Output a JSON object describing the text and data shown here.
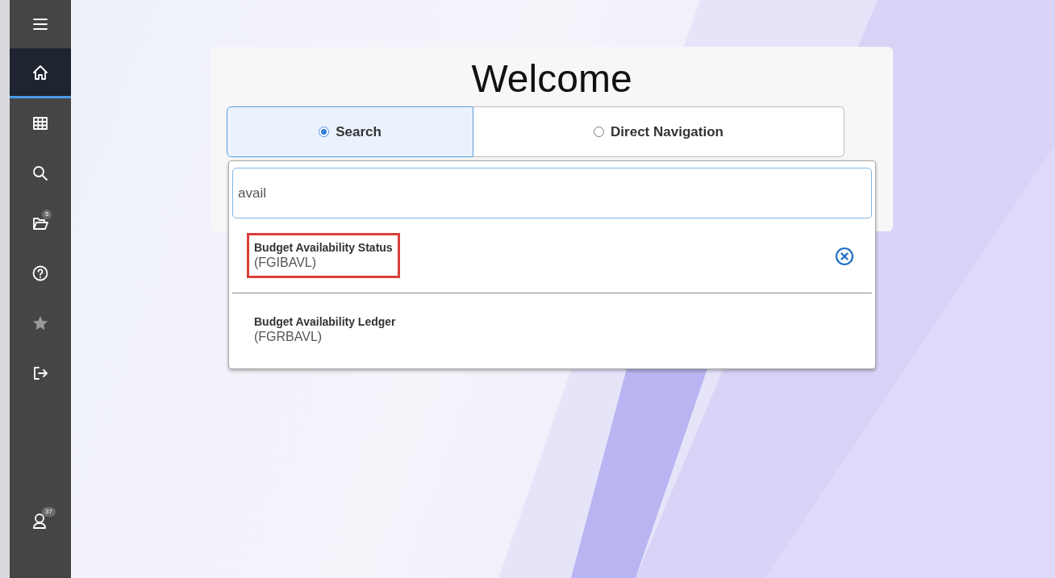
{
  "sidebar": {
    "items": [
      {
        "kind": "menu",
        "selected": false,
        "disabled": false
      },
      {
        "kind": "home",
        "selected": true,
        "disabled": false
      },
      {
        "kind": "grid",
        "selected": false,
        "disabled": false
      },
      {
        "kind": "search",
        "selected": false,
        "disabled": false
      },
      {
        "kind": "folder",
        "selected": false,
        "disabled": false,
        "badge": "5"
      },
      {
        "kind": "help",
        "selected": false,
        "disabled": false
      },
      {
        "kind": "star",
        "selected": false,
        "disabled": true
      },
      {
        "kind": "logout",
        "selected": false,
        "disabled": false
      }
    ],
    "bottom": {
      "kind": "profile",
      "badge": "37"
    }
  },
  "welcome": {
    "title": "Welcome",
    "modes": [
      {
        "label": "Search",
        "selected": true
      },
      {
        "label": "Direct Navigation",
        "selected": false
      }
    ],
    "search": {
      "value": "avail"
    },
    "results": [
      {
        "name": "Budget Availability Status",
        "code": "(FGIBAVL)",
        "highlighted": true,
        "clear_button": true
      },
      {
        "name": "Budget Availability Ledger",
        "code": "(FGRBAVL)",
        "highlighted": false,
        "clear_button": false
      }
    ]
  }
}
